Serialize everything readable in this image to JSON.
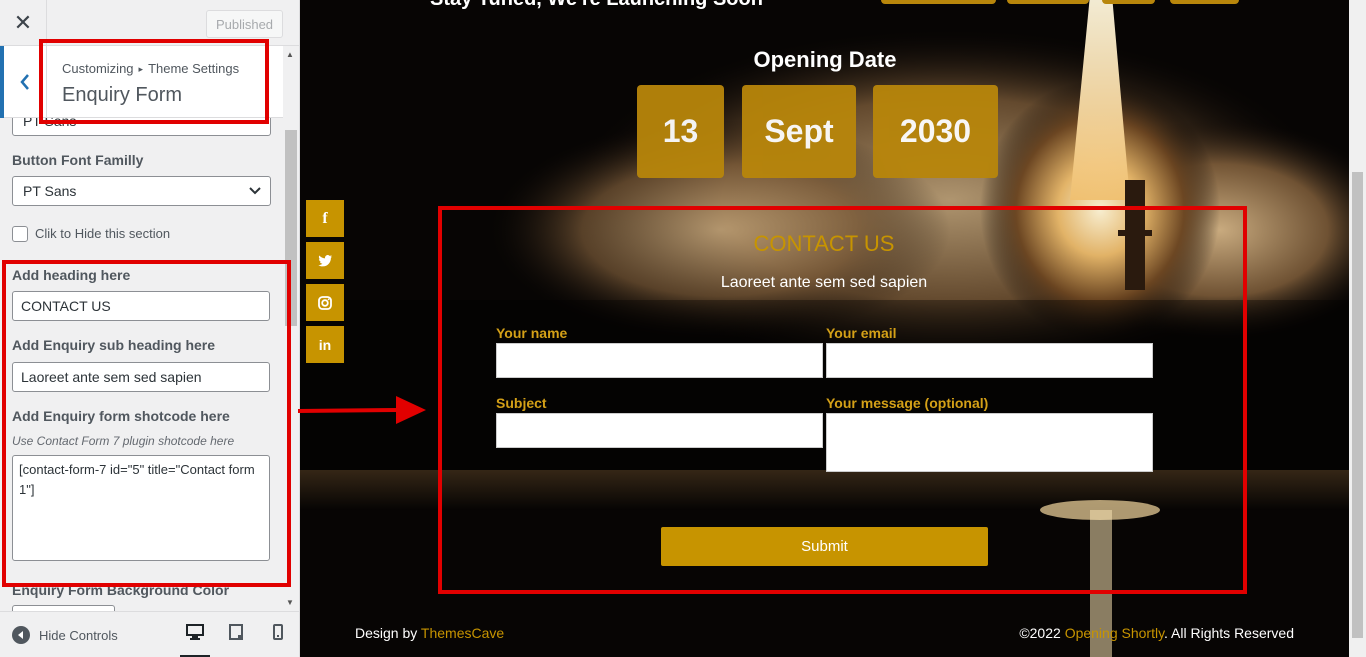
{
  "sidebar": {
    "close_label": "✕",
    "published_label": "Published",
    "breadcrumb_root": "Customizing",
    "breadcrumb_sep": "▸",
    "breadcrumb_parent": "Theme Settings",
    "section_title": "Enquiry Form",
    "prev_select_value": "PT Sans",
    "button_font_label": "Button Font Familly",
    "button_font_value": "PT Sans",
    "hide_section_label": "Clik to Hide this section",
    "heading_label": "Add heading here",
    "heading_value": "CONTACT US",
    "subheading_label": "Add Enquiry sub heading here",
    "subheading_value": "Laoreet ante sem sed sapien",
    "shortcode_label": "Add Enquiry form shotcode here",
    "shortcode_desc": "Use Contact Form 7 plugin shotcode here",
    "shortcode_value": "[contact-form-7 id=\"5\" title=\"Contact form 1\"]",
    "bg_color_label": "Enquiry Form Background Color",
    "hide_controls_label": "Hide Controls"
  },
  "preview": {
    "top_heading": "Stay Tuned, We're Launching Soon",
    "opening_title": "Opening Date",
    "date": {
      "day": "13",
      "month": "Sept",
      "year": "2030"
    },
    "social": [
      "f",
      "t",
      "ig",
      "in"
    ],
    "contact_heading": "CONTACT US",
    "contact_sub": "Laoreet ante sem sed sapien",
    "labels": {
      "name": "Your name",
      "email": "Your email",
      "subject": "Subject",
      "message": "Your message (optional)"
    },
    "submit_label": "Submit",
    "footer": {
      "design_by": "Design by ",
      "design_link": "ThemesCave",
      "copyright": "©2022 ",
      "copyright_link": "Opening Shortly",
      "rights": ". All Rights Reserved"
    }
  },
  "colors": {
    "accent": "#c79400",
    "annotation": "#e10000",
    "wp_blue": "#2271b1"
  }
}
